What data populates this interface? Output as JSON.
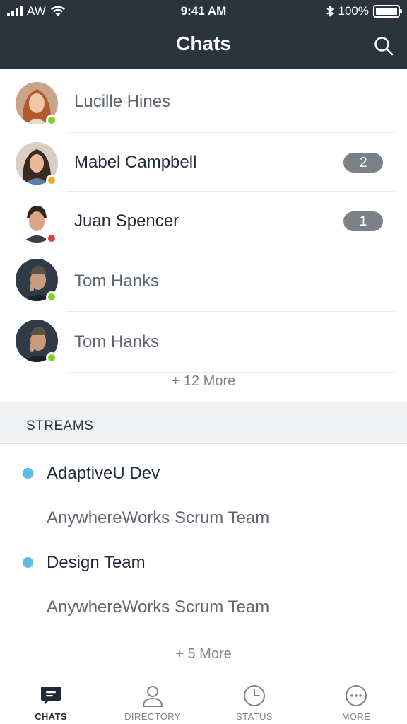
{
  "status_bar": {
    "carrier": "AW",
    "time": "9:41 AM",
    "battery": "100%"
  },
  "header": {
    "title": "Chats"
  },
  "chats": [
    {
      "name": "Lucille Hines",
      "status_color": "#7ed321",
      "unread": false,
      "badge": ""
    },
    {
      "name": "Mabel Campbell",
      "status_color": "#f5a623",
      "unread": true,
      "badge": "2"
    },
    {
      "name": "Juan Spencer",
      "status_color": "#d0454c",
      "unread": true,
      "badge": "1"
    },
    {
      "name": "Tom Hanks",
      "status_color": "#7ed321",
      "unread": false,
      "badge": ""
    },
    {
      "name": "Tom Hanks",
      "status_color": "#7ed321",
      "unread": false,
      "badge": ""
    }
  ],
  "chats_more": "+ 12 More",
  "streams": {
    "title": "STREAMS",
    "items": [
      {
        "name": "AdaptiveU Dev",
        "unread": true
      },
      {
        "name": "AnywhereWorks Scrum Team",
        "unread": false
      },
      {
        "name": "Design Team",
        "unread": true
      },
      {
        "name": "AnywhereWorks Scrum Team",
        "unread": false
      }
    ],
    "more": "+ 5 More"
  },
  "tabs": [
    {
      "label": "CHATS",
      "icon": "chat-bubble-icon",
      "active": true
    },
    {
      "label": "DIRECTORY",
      "icon": "person-icon",
      "active": false
    },
    {
      "label": "STATUS",
      "icon": "clock-icon",
      "active": false
    },
    {
      "label": "MORE",
      "icon": "more-dots-icon",
      "active": false
    }
  ],
  "colors": {
    "header_bg": "#2b333c",
    "online": "#7ed321",
    "away": "#f5a623",
    "busy": "#d0454c",
    "stream_dot": "#5bbbe6",
    "badge_bg": "#7a8189"
  }
}
